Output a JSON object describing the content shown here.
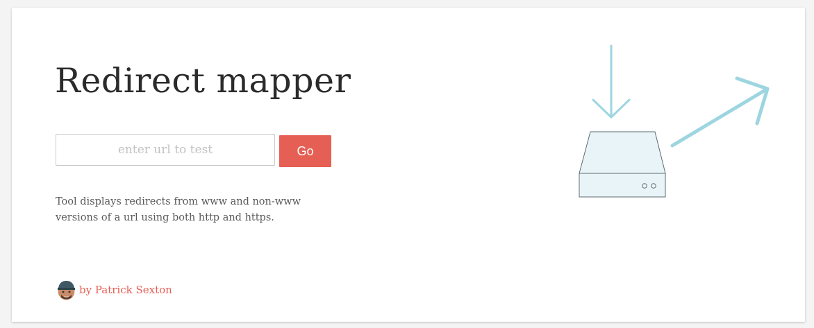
{
  "page": {
    "title": "Redirect mapper",
    "description": "Tool displays redirects from www and non-www versions of a url using both http and https."
  },
  "form": {
    "url_placeholder": "enter url to test",
    "url_value": "",
    "go_label": "Go"
  },
  "credit": {
    "text": "by Patrick Sexton"
  },
  "colors": {
    "accent": "#e55f55",
    "arrow": "#9dd5e0",
    "server_fill": "#e8f4f7",
    "server_stroke": "#5d6b70",
    "title_text": "#2b2b2b",
    "body_text": "#5a5a5a"
  },
  "icons": {
    "avatar": "author-avatar",
    "illustration": "server-redirect-illustration"
  }
}
